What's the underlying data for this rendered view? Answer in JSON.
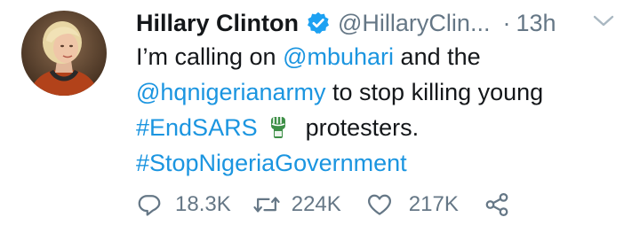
{
  "tweet": {
    "author_name": "Hillary Clinton",
    "handle": "@HillaryClin...",
    "separator": "·",
    "time": "13h",
    "body": {
      "line1_text": "I’m calling on ",
      "mention1": "@mbuhari",
      "line1_tail": " and the",
      "mention2": "@hqnigerianarmy",
      "line2_tail": " to stop killing young",
      "hashtag1": "#EndSARS",
      "line3_tail": "protesters.",
      "hashtag2": "#StopNigeriaGovernment"
    },
    "actions": {
      "reply_count": "18.3K",
      "retweet_count": "224K",
      "like_count": "217K"
    }
  },
  "colors": {
    "link": "#1b95e0",
    "secondary_text": "#657786",
    "verified_badge": "#1da1f2",
    "emoji_fist": "#3e8f47"
  },
  "icons": {
    "verified": "verified-badge-icon",
    "caret": "chevron-down-icon",
    "emoji": "raised-fist-emoji",
    "reply": "reply-icon",
    "retweet": "retweet-icon",
    "like": "heart-icon",
    "share": "share-icon"
  }
}
